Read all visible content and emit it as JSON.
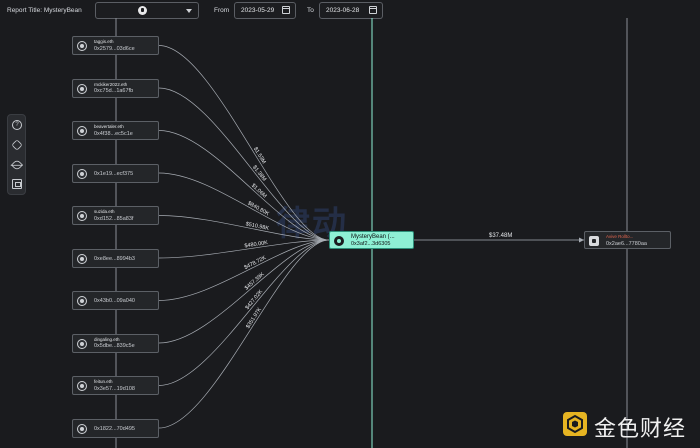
{
  "header": {
    "report_title": "Report Title: MysteryBean",
    "token_icon": "token-logo-icon",
    "from_label": "From",
    "from_date": "2023-05-29",
    "to_label": "To",
    "to_date": "2023-06-28"
  },
  "toolbar": {
    "help_glyph": "?",
    "icons": [
      "help-icon",
      "hexagon-icon",
      "hide-icon",
      "export-icon"
    ]
  },
  "sources": [
    {
      "name": "taggis.eth",
      "address": "0x2579...03d6ce",
      "amount": "$1.53M"
    },
    {
      "name": "rnckiker2022.eth",
      "address": "0xc75d...1a67fb",
      "amount": "$1.38M"
    },
    {
      "name": "beavertaler.eth",
      "address": "0x4f38...ec5c1e",
      "amount": "$1.06M"
    },
    {
      "name": "",
      "address": "0x1e19...ecf375",
      "amount": "$840.80K"
    },
    {
      "name": "suzida.eth",
      "address": "0xd152...85a83f",
      "amount": "$510.98K"
    },
    {
      "name": "",
      "address": "0xe8ee...8994b3",
      "amount": "$480.00K"
    },
    {
      "name": "",
      "address": "0x43b0...09a040",
      "amount": "$478.72K"
    },
    {
      "name": "dingaling.eth",
      "address": "0x5dbe...839c5e",
      "amount": "$457.39K"
    },
    {
      "name": "feitun.eth",
      "address": "0x3e57...19d108",
      "amount": "$427.02K"
    },
    {
      "name": "",
      "address": "0x1822...70d495",
      "amount": "$351.97K"
    }
  ],
  "center": {
    "name": "MysteryBean (...",
    "address": "0x3af2...3d6305"
  },
  "outflow": {
    "amount": "$37.48M"
  },
  "destination": {
    "name": "Avive Rollto...",
    "address": "0x2ae6...7780aa"
  },
  "watermark": "律动",
  "brand": {
    "text": "金色财经"
  },
  "colors": {
    "background": "#1a1b1e",
    "center_node": "#8ef0d5",
    "destination_label": "#e0654f",
    "edge": "#a7acb3"
  }
}
